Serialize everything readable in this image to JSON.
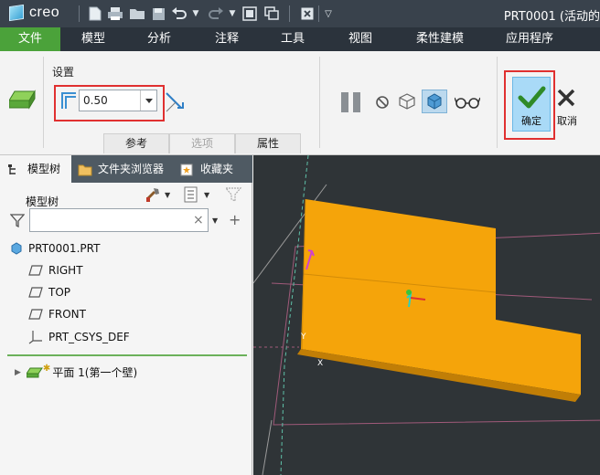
{
  "app": {
    "logo_text": "creo",
    "document_title": "PRT0001 (活动的"
  },
  "ribbon_tabs": [
    {
      "label": "文件"
    },
    {
      "label": "模型"
    },
    {
      "label": "分析"
    },
    {
      "label": "注释"
    },
    {
      "label": "工具"
    },
    {
      "label": "视图"
    },
    {
      "label": "柔性建模"
    },
    {
      "label": "应用程序"
    }
  ],
  "settings": {
    "group_label": "设置",
    "thickness_value": "0.50"
  },
  "subtabs": [
    {
      "label": "参考"
    },
    {
      "label": "选项"
    },
    {
      "label": "属性"
    }
  ],
  "actions": {
    "ok_label": "确定",
    "cancel_label": "取消"
  },
  "left_tabs": [
    {
      "label": "模型树"
    },
    {
      "label": "文件夹浏览器"
    },
    {
      "label": "收藏夹"
    }
  ],
  "tree": {
    "title": "模型树",
    "filter_value": "",
    "items": [
      {
        "label": "PRT0001.PRT"
      },
      {
        "label": "RIGHT"
      },
      {
        "label": "TOP"
      },
      {
        "label": "FRONT"
      },
      {
        "label": "PRT_CSYS_DEF"
      },
      {
        "label": "平面 1(第一个壁)"
      }
    ]
  },
  "viewport": {
    "axis_x": "X",
    "axis_y": "Y",
    "part_color": "#f5a40a"
  }
}
